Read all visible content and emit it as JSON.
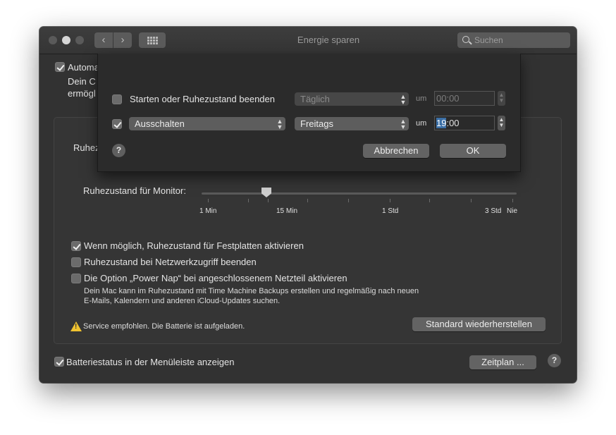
{
  "window": {
    "title": "Energie sparen",
    "search_placeholder": "Suchen",
    "nav_back": "‹",
    "nav_forward": "›"
  },
  "background": {
    "automatic_label": "Automa",
    "desc_line1": "Dein C",
    "desc_line2": "ermögl",
    "ruhe_label": "Ruhez",
    "monitor_label": "Ruhezustand für Monitor:",
    "slider": {
      "ticks": [
        "1 Min",
        "15 Min",
        "1 Std",
        "3 Std",
        "Nie"
      ],
      "value": "15 Min"
    },
    "options": [
      {
        "label": "Wenn möglich, Ruhezustand für Festplatten aktivieren",
        "checked": true
      },
      {
        "label": "Ruhezustand bei Netzwerkzugriff beenden",
        "checked": false
      },
      {
        "label": "Die Option „Power Nap“ bei angeschlossenem Netzteil aktivieren",
        "checked": false
      }
    ],
    "power_nap_desc1": "Dein Mac kann im Ruhezustand mit Time Machine Backups erstellen und regelmäßig nach neuen",
    "power_nap_desc2": "E-Mails, Kalendern und anderen iCloud-Updates suchen.",
    "warning": "Service empfohlen. Die Batterie ist aufgeladen.",
    "restore_button": "Standard wiederherstellen",
    "battery_status": "Batteriestatus in der Menüleiste anzeigen",
    "schedule_button": "Zeitplan ...",
    "help": "?"
  },
  "sheet": {
    "row1": {
      "label": "Starten oder Ruhezustand beenden",
      "checked": false,
      "day": "Täglich",
      "um": "um",
      "time": "00:00"
    },
    "row2": {
      "action": "Ausschalten",
      "checked": true,
      "day": "Freitags",
      "um": "um",
      "time_hour": "19",
      "time_rest": ":00"
    },
    "cancel": "Abbrechen",
    "ok": "OK",
    "help": "?"
  },
  "colors": {
    "window_bg": "#323232",
    "sheet_bg": "#2b2b2b",
    "selection": "#3b6fa6",
    "warning": "#f0c330"
  }
}
